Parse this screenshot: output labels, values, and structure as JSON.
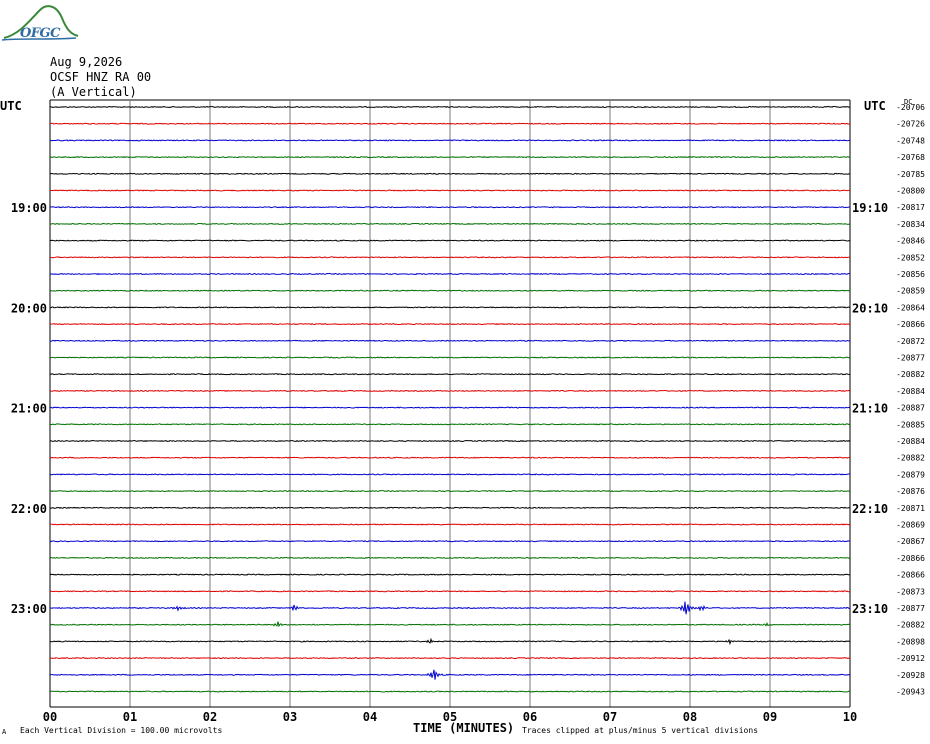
{
  "logo": {
    "text": "OFGC"
  },
  "header": {
    "date": "Aug 9,2026",
    "station": "OCSF HNZ RA 00",
    "component": "(A Vertical)"
  },
  "left_axis_unit": "UTC",
  "right_axis_unit": "UTC",
  "right_top_label": "DC",
  "footer": {
    "scale_note": "Each Vertical Division =  100.00 microvolts",
    "clip_note": "Traces clipped at plus/minus 5 vertical divisions",
    "corner_mark": "A"
  },
  "colors": {
    "black": "#000000",
    "red": "#e00000",
    "blue": "#0000d0",
    "green": "#007000",
    "grid": "#7a7a7a"
  },
  "chart_data": {
    "type": "line",
    "title": "",
    "xlabel": "TIME (MINUTES)",
    "ylabel": "",
    "xlim": [
      0,
      10
    ],
    "x_ticks": [
      "00",
      "01",
      "02",
      "03",
      "04",
      "05",
      "06",
      "07",
      "08",
      "09",
      "10"
    ],
    "grid": true,
    "trace_color_cycle": [
      "black",
      "red",
      "blue",
      "green"
    ],
    "left_hour_labels": [
      {
        "trace_index": 6,
        "label": "19:00"
      },
      {
        "trace_index": 12,
        "label": "20:00"
      },
      {
        "trace_index": 18,
        "label": "21:00"
      },
      {
        "trace_index": 24,
        "label": "22:00"
      },
      {
        "trace_index": 30,
        "label": "23:00"
      }
    ],
    "right_hour_labels": [
      {
        "trace_index": 6,
        "label": "19:10"
      },
      {
        "trace_index": 12,
        "label": "20:10"
      },
      {
        "trace_index": 18,
        "label": "21:10"
      },
      {
        "trace_index": 24,
        "label": "22:10"
      },
      {
        "trace_index": 30,
        "label": "23:10"
      }
    ],
    "dc_offsets": [
      -20706,
      -20726,
      -20748,
      -20768,
      -20785,
      -20800,
      -20817,
      -20834,
      -20846,
      -20852,
      -20856,
      -20859,
      -20864,
      -20866,
      -20872,
      -20877,
      -20882,
      -20884,
      -20887,
      -20885,
      -20884,
      -20882,
      -20879,
      -20876,
      -20871,
      -20869,
      -20867,
      -20866,
      -20866,
      -20873,
      -20877,
      -20882,
      -20898,
      -20912,
      -20928,
      -20943
    ],
    "events": [
      {
        "trace_index": 30,
        "minute": 1.6,
        "amplitude": 0.25
      },
      {
        "trace_index": 30,
        "minute": 3.05,
        "amplitude": 0.4
      },
      {
        "trace_index": 30,
        "minute": 7.95,
        "amplitude": 1.0
      },
      {
        "trace_index": 30,
        "minute": 8.15,
        "amplitude": 0.35
      },
      {
        "trace_index": 31,
        "minute": 2.85,
        "amplitude": 0.3
      },
      {
        "trace_index": 31,
        "minute": 8.95,
        "amplitude": 0.15
      },
      {
        "trace_index": 32,
        "minute": 4.75,
        "amplitude": 0.3
      },
      {
        "trace_index": 32,
        "minute": 8.5,
        "amplitude": 0.25
      },
      {
        "trace_index": 34,
        "minute": 4.8,
        "amplitude": 0.7
      }
    ]
  }
}
